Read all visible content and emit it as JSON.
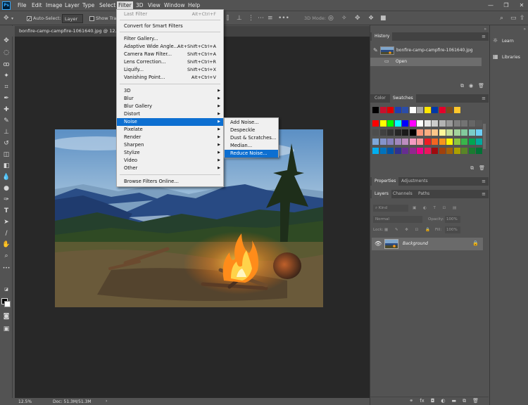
{
  "app": {
    "logo": "Ps"
  },
  "menubar": {
    "items": [
      "File",
      "Edit",
      "Image",
      "Layer",
      "Type",
      "Select",
      "Filter",
      "3D",
      "View",
      "Window",
      "Help"
    ],
    "active": "Filter"
  },
  "window_controls": {
    "minimize": "—",
    "restore": "❐",
    "close": "✕"
  },
  "options_bar": {
    "auto_select_label": "Auto-Select:",
    "auto_select_checked": true,
    "auto_select_target": "Layer",
    "show_transform_label": "Show Tra",
    "mode_3d_label": "3D Mode:"
  },
  "document": {
    "tab_title": "bonfire-camp-campfire-1061640.jpg @ 12.5%",
    "zoom": "12.5%",
    "doc_size": "Doc: 51.3M/51.3M"
  },
  "filter_menu": {
    "last_filter": {
      "label": "Last Filter",
      "shortcut": "Alt+Ctrl+F",
      "disabled": true
    },
    "convert_smart": "Convert for Smart Filters",
    "group2": [
      {
        "label": "Filter Gallery...",
        "shortcut": ""
      },
      {
        "label": "Adaptive Wide Angle...",
        "shortcut": "Alt+Shift+Ctrl+A"
      },
      {
        "label": "Camera Raw Filter...",
        "shortcut": "Shift+Ctrl+A"
      },
      {
        "label": "Lens Correction...",
        "shortcut": "Shift+Ctrl+R"
      },
      {
        "label": "Liquify...",
        "shortcut": "Shift+Ctrl+X"
      },
      {
        "label": "Vanishing Point...",
        "shortcut": "Alt+Ctrl+V"
      }
    ],
    "submenus": [
      "3D",
      "Blur",
      "Blur Gallery",
      "Distort",
      "Noise",
      "Pixelate",
      "Render",
      "Sharpen",
      "Stylize",
      "Video",
      "Other"
    ],
    "highlighted": "Noise",
    "browse_online": "Browse Filters Online..."
  },
  "noise_submenu": {
    "items": [
      "Add Noise...",
      "Despeckle",
      "Dust & Scratches...",
      "Median...",
      "Reduce Noise..."
    ],
    "highlighted": "Reduce Noise..."
  },
  "history_panel": {
    "tab": "History",
    "snapshot_name": "bonfire-camp-campfire-1061640.jpg",
    "states": [
      "Open"
    ]
  },
  "color_panel": {
    "tabs": [
      "Color",
      "Swatches"
    ],
    "active_tab": "Swatches",
    "recent_swatches": [
      "#000000",
      "#c8102e",
      "#e00000",
      "#1f3fb0",
      "#2b4da8",
      "#ffffff",
      "#a6a6a6",
      "#ffe600",
      "#0038a8",
      "#e4002b",
      "#7a4a1e",
      "#ffc72c"
    ],
    "swatch_rows": [
      [
        "#ff0000",
        "#ffff00",
        "#00ff00",
        "#00ffff",
        "#0000ff",
        "#ff00ff",
        "#ffffff",
        "#e6e6e6",
        "#cccccc",
        "#b3b3b3",
        "#999999",
        "#808080",
        "#737373",
        "#666666",
        "#595959"
      ],
      [
        "#4d4d4d",
        "#404040",
        "#333333",
        "#262626",
        "#1a1a1a",
        "#000000",
        "#f7977a",
        "#f9ad81",
        "#fdc68a",
        "#fff79a",
        "#c4df9b",
        "#a3d39c",
        "#82ca9d",
        "#7bcdc8",
        "#6ecff6"
      ],
      [
        "#7ea7d8",
        "#8493ca",
        "#8882be",
        "#a187be",
        "#bc8dbf",
        "#f49ac2",
        "#f6989d",
        "#ed1c24",
        "#f26522",
        "#f7941d",
        "#fff200",
        "#8dc73f",
        "#39b54a",
        "#00a651",
        "#00a99d"
      ],
      [
        "#00aeef",
        "#0072bc",
        "#0054a6",
        "#2e3192",
        "#662d91",
        "#92278f",
        "#ec008c",
        "#ed145b",
        "#9e0b0f",
        "#a0410d",
        "#a36209",
        "#aba000",
        "#598527",
        "#1a7b30",
        "#007236"
      ]
    ]
  },
  "properties_panel": {
    "tabs": [
      "Properties",
      "Adjustments"
    ],
    "active_tab": "Properties"
  },
  "layers_panel": {
    "tabs": [
      "Layers",
      "Channels",
      "Paths"
    ],
    "active_tab": "Layers",
    "kind_label": "Kind",
    "blend_mode": "Normal",
    "opacity_label": "Opacity:",
    "opacity_value": "100%",
    "lock_label": "Lock:",
    "fill_label": "Fill:",
    "fill_value": "100%",
    "layers": [
      {
        "name": "Background",
        "visible": true,
        "locked": true
      }
    ],
    "footer_icons": [
      "link-icon",
      "fx-icon",
      "mask-icon",
      "adjustment-icon",
      "group-icon",
      "new-layer-icon",
      "trash-icon"
    ]
  },
  "learn_column": {
    "learn": "Learn",
    "libraries": "Libraries"
  },
  "colors": {
    "highlight": "#0d6fd1",
    "menu_bg": "#f0f0f0",
    "ui_bg": "#535353",
    "canvas_bg": "#282828"
  }
}
